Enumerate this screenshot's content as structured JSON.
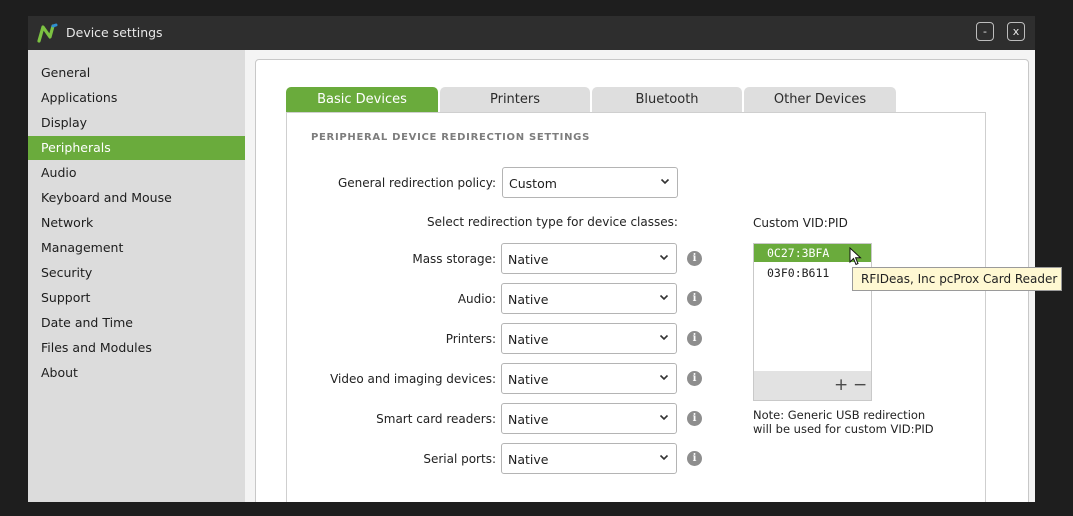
{
  "window": {
    "title": "Device settings",
    "minimize_label": "-",
    "close_label": "x"
  },
  "sidebar": {
    "items": [
      {
        "label": "General"
      },
      {
        "label": "Applications"
      },
      {
        "label": "Display"
      },
      {
        "label": "Peripherals",
        "active": true
      },
      {
        "label": "Audio"
      },
      {
        "label": "Keyboard and Mouse"
      },
      {
        "label": "Network"
      },
      {
        "label": "Management"
      },
      {
        "label": "Security"
      },
      {
        "label": "Support"
      },
      {
        "label": "Date and Time"
      },
      {
        "label": "Files and Modules"
      },
      {
        "label": "About"
      }
    ]
  },
  "tabs": [
    {
      "label": "Basic Devices",
      "active": true
    },
    {
      "label": "Printers"
    },
    {
      "label": "Bluetooth"
    },
    {
      "label": "Other Devices"
    }
  ],
  "section_title": "PERIPHERAL DEVICE REDIRECTION SETTINGS",
  "general_policy": {
    "label": "General redirection policy:",
    "value": "Custom"
  },
  "device_classes_heading": "Select redirection type for device classes:",
  "device_classes": [
    {
      "label": "Mass storage:",
      "value": "Native"
    },
    {
      "label": "Audio:",
      "value": "Native"
    },
    {
      "label": "Printers:",
      "value": "Native"
    },
    {
      "label": "Video and imaging devices:",
      "value": "Native"
    },
    {
      "label": "Smart card readers:",
      "value": "Native"
    },
    {
      "label": "Serial ports:",
      "value": "Native"
    }
  ],
  "custom_vid_pid": {
    "heading": "Custom  VID:PID",
    "items": [
      "0C27:3BFA",
      "03F0:B611"
    ],
    "selected": "0C27:3BFA",
    "add_label": "+",
    "remove_label": "−",
    "note_line1": "Note: Generic USB redirection",
    "note_line2": "will be used for custom VID:PID"
  },
  "tooltip": "RFIDeas, Inc pcProx Card Reader",
  "colors": {
    "accent": "#6aab3c",
    "titlebar": "#2e2e2e",
    "sidebar": "#dcdcdc",
    "tooltip_bg": "#fff8d2"
  },
  "icons": {
    "logo": "n-logo-icon",
    "chevron": "chevron-down-icon",
    "info": "info-icon",
    "cursor": "mouse-pointer-icon"
  }
}
